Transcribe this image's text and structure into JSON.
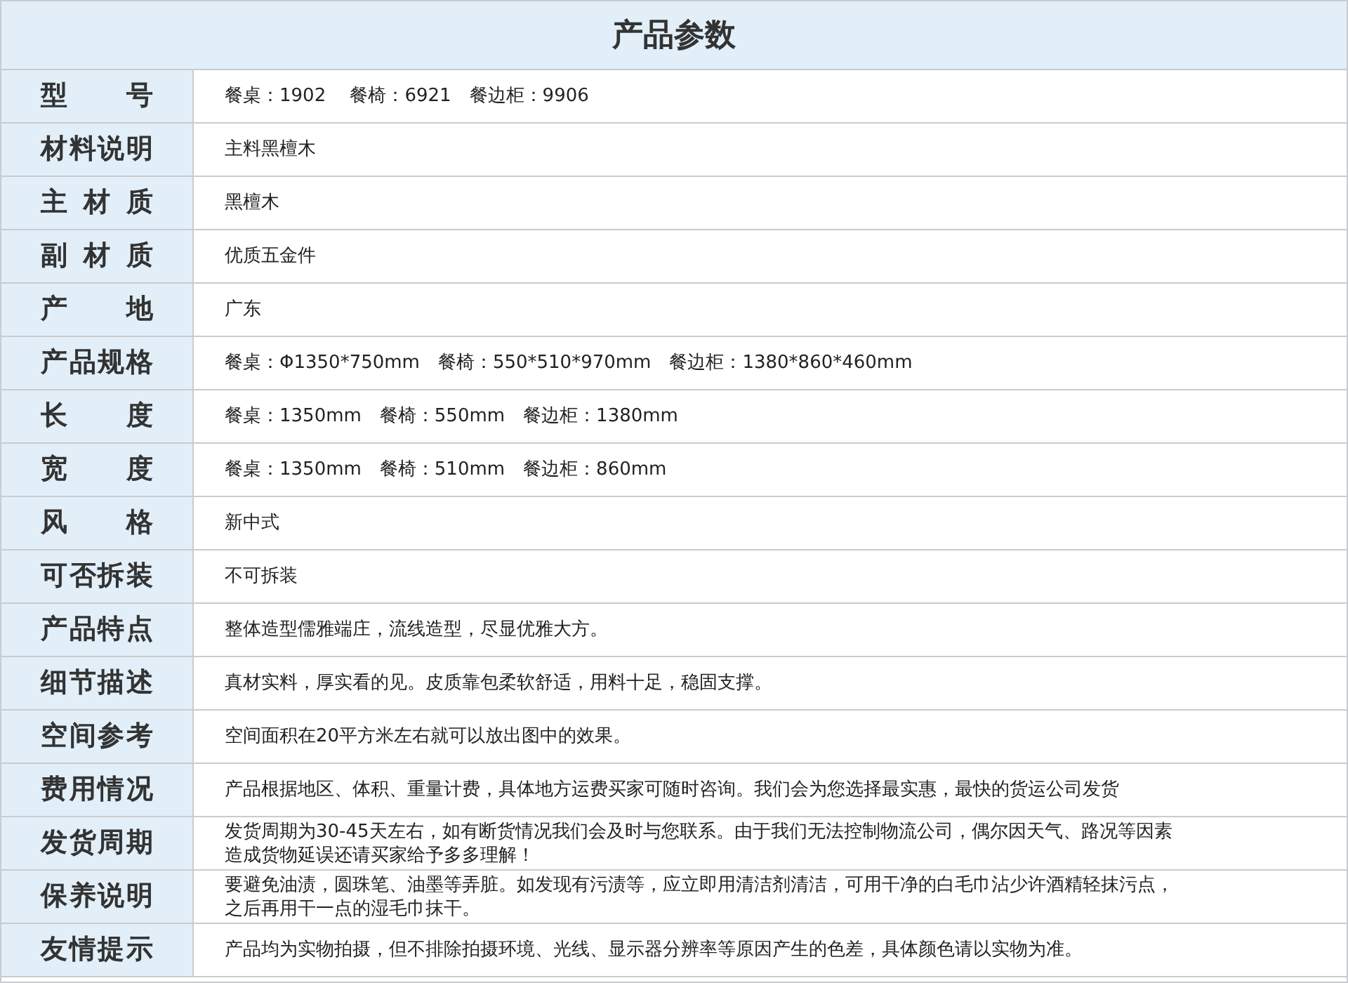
{
  "title": "产品参数",
  "rows": [
    {
      "label": "型 号",
      "value": "餐桌：1902　 餐椅：6921　餐边柜：9906"
    },
    {
      "label": "材料说明",
      "value": "主料黑檀木"
    },
    {
      "label": "主 材 质",
      "value": "黑檀木"
    },
    {
      "label": "副 材 质",
      "value": "优质五金件"
    },
    {
      "label": "产 地",
      "value": "广东"
    },
    {
      "label": "产品规格",
      "value": "餐桌：Φ1350*750mm　餐椅：550*510*970mm　餐边柜：1380*860*460mm"
    },
    {
      "label": "长 度",
      "value": "餐桌：1350mm　餐椅：550mm　餐边柜：1380mm"
    },
    {
      "label": "宽 度",
      "value": "餐桌：1350mm　餐椅：510mm　餐边柜：860mm"
    },
    {
      "label": "风 格",
      "value": "新中式"
    },
    {
      "label": "可否拆装",
      "value": "不可拆装"
    },
    {
      "label": "产品特点",
      "value": "整体造型儒雅端庄，流线造型，尽显优雅大方。"
    },
    {
      "label": "细节描述",
      "value": "真材实料，厚实看的见。皮质靠包柔软舒适，用料十足，稳固支撑。"
    },
    {
      "label": "空间参考",
      "value": "空间面积在20平方米左右就可以放出图中的效果。"
    },
    {
      "label": "费用情况",
      "value": "产品根据地区、体积、重量计费，具体地方运费买家可随时咨询。我们会为您选择最实惠，最快的货运公司发货"
    },
    {
      "label": "发货周期",
      "lines": [
        "发货周期为30-45天左右，如有断货情况我们会及时与您联系。由于我们无法控制物流公司，偶尔因天气、路况等因素",
        "造成货物延误还请买家给予多多理解！"
      ]
    },
    {
      "label": "保养说明",
      "lines": [
        "要避免油渍，圆珠笔、油墨等弄脏。如发现有污渍等，应立即用清洁剂清洁，可用干净的白毛巾沾少许酒精轻抹污点，",
        "之后再用干一点的湿毛巾抹干。"
      ]
    },
    {
      "label": "友情提示",
      "value": "产品均为实物拍摄，但不排除拍摄环境、光线、显示器分辨率等原因产生的色差，具体颜色请以实物为准。"
    }
  ]
}
